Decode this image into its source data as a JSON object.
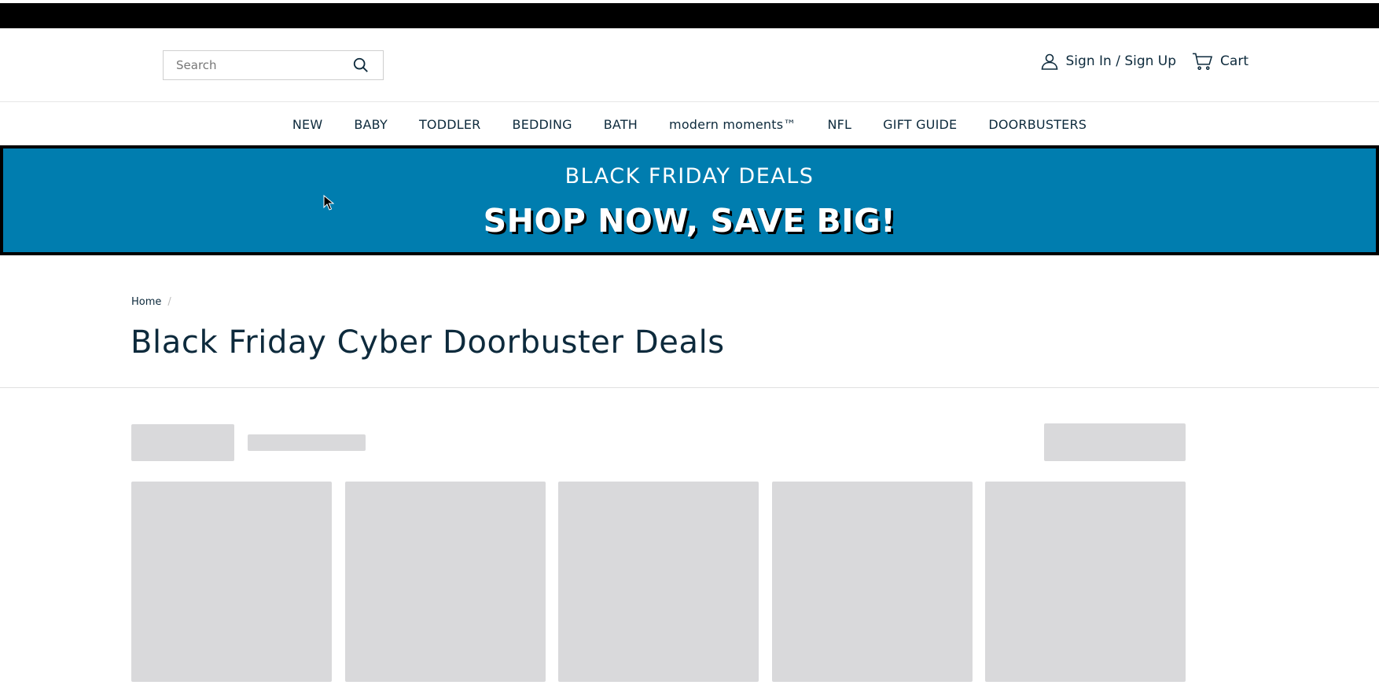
{
  "header": {
    "search": {
      "placeholder": "Search",
      "value": ""
    },
    "account_label": "Sign In / Sign Up",
    "cart_label": "Cart"
  },
  "nav": {
    "items": [
      "NEW",
      "BABY",
      "TODDLER",
      "BEDDING",
      "BATH",
      "modern moments™",
      "NFL",
      "GIFT GUIDE",
      "DOORBUSTERS"
    ]
  },
  "promo": {
    "line1": "BLACK FRIDAY DEALS",
    "line2": "SHOP NOW, SAVE BIG!",
    "background_color": "#007daf"
  },
  "breadcrumb": {
    "home": "Home",
    "separator": "/"
  },
  "page_title": "Black Friday Cyber Doorbuster Deals",
  "colors": {
    "text": "#0d2a3c",
    "skeleton": "#d9d9db"
  },
  "icons": [
    "search-icon",
    "user-icon",
    "cart-icon",
    "cursor-icon"
  ]
}
